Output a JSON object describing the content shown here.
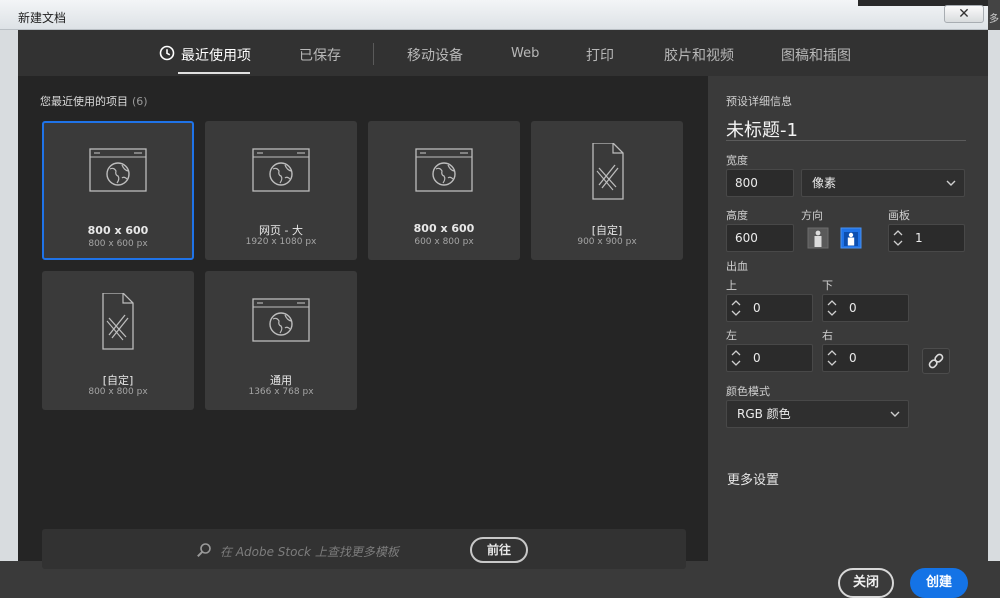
{
  "window": {
    "title": "新建文档",
    "close_label": "✕",
    "edge_glyph": "多"
  },
  "tabs": [
    {
      "label": "最近使用项"
    },
    {
      "label": "已保存"
    },
    {
      "label": "移动设备"
    },
    {
      "label": "Web"
    },
    {
      "label": "打印"
    },
    {
      "label": "胶片和视频"
    },
    {
      "label": "图稿和插图"
    }
  ],
  "recent": {
    "label": "您最近使用的项目",
    "count": "(6)",
    "items": [
      {
        "name": "800 x 600",
        "size": "800 x 600 px",
        "icon": "web-document-icon"
      },
      {
        "name": "网页 - 大",
        "size": "1920 x 1080 px",
        "icon": "web-document-icon"
      },
      {
        "name": "800 x 600",
        "size": "600 x 800 px",
        "icon": "web-document-icon"
      },
      {
        "name": "[自定]",
        "size": "900 x 900 px",
        "icon": "custom-document-icon"
      },
      {
        "name": "[自定]",
        "size": "800 x 800 px",
        "icon": "custom-document-icon"
      },
      {
        "name": "通用",
        "size": "1366 x 768 px",
        "icon": "web-document-icon"
      }
    ]
  },
  "stock": {
    "placeholder": "在 Adobe Stock 上查找更多模板",
    "go_label": "前往"
  },
  "details": {
    "header": "预设详细信息",
    "doc_title": "未标题-1",
    "width_label": "宽度",
    "width_value": "800",
    "unit": "像素",
    "height_label": "高度",
    "height_value": "600",
    "orientation_label": "方向",
    "artboard_label": "画板",
    "artboard_value": "1",
    "bleed_label": "出血",
    "bleed": {
      "top_label": "上",
      "top_value": "0",
      "bottom_label": "下",
      "bottom_value": "0",
      "left_label": "左",
      "left_value": "0",
      "right_label": "右",
      "right_value": "0"
    },
    "color_mode_label": "颜色模式",
    "color_mode_value": "RGB 颜色",
    "more_settings": "更多设置",
    "close_label": "关闭",
    "create_label": "创建"
  },
  "colors": {
    "accent": "#1473e6",
    "selected_border": "#1f73e8"
  }
}
